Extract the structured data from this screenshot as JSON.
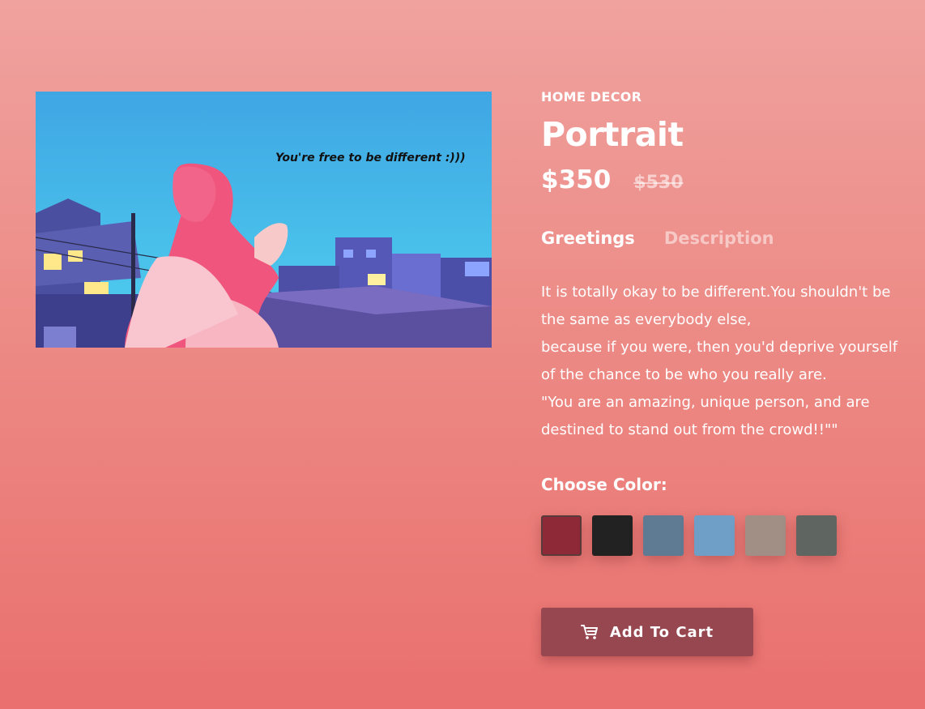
{
  "product": {
    "image_caption": "You're free to be different :)))",
    "category": "HOME DECOR",
    "title": "Portrait",
    "price": "$350",
    "old_price": "$530"
  },
  "tabs": [
    {
      "label": "Greetings",
      "active": true
    },
    {
      "label": "Description",
      "active": false
    }
  ],
  "description": {
    "line1": "It is totally okay to be different.You shouldn't be the same as everybody else,",
    "line2": "because if you were, then you'd deprive yourself of the chance to be who you really are.",
    "line3": "\"You are an amazing, unique person, and are destined to stand out from the crowd!!\"\""
  },
  "color_picker": {
    "label": "Choose Color:",
    "swatches": [
      {
        "name": "crimson",
        "color": "#8e2a37",
        "selected": true
      },
      {
        "name": "black",
        "color": "#222222",
        "selected": false
      },
      {
        "name": "denim-mottled",
        "color": "#5f7b94",
        "selected": false
      },
      {
        "name": "sky-blue",
        "color": "#6f9ec7",
        "selected": false
      },
      {
        "name": "taupe",
        "color": "#a18e85",
        "selected": false
      },
      {
        "name": "slate-gray",
        "color": "#5f6560",
        "selected": false
      }
    ]
  },
  "cart": {
    "label": "Add To Cart",
    "icon": "shopping-cart-icon"
  },
  "colors": {
    "accent": "#97474f",
    "background_top": "#f0a29f",
    "background_bottom": "#e9706e"
  }
}
